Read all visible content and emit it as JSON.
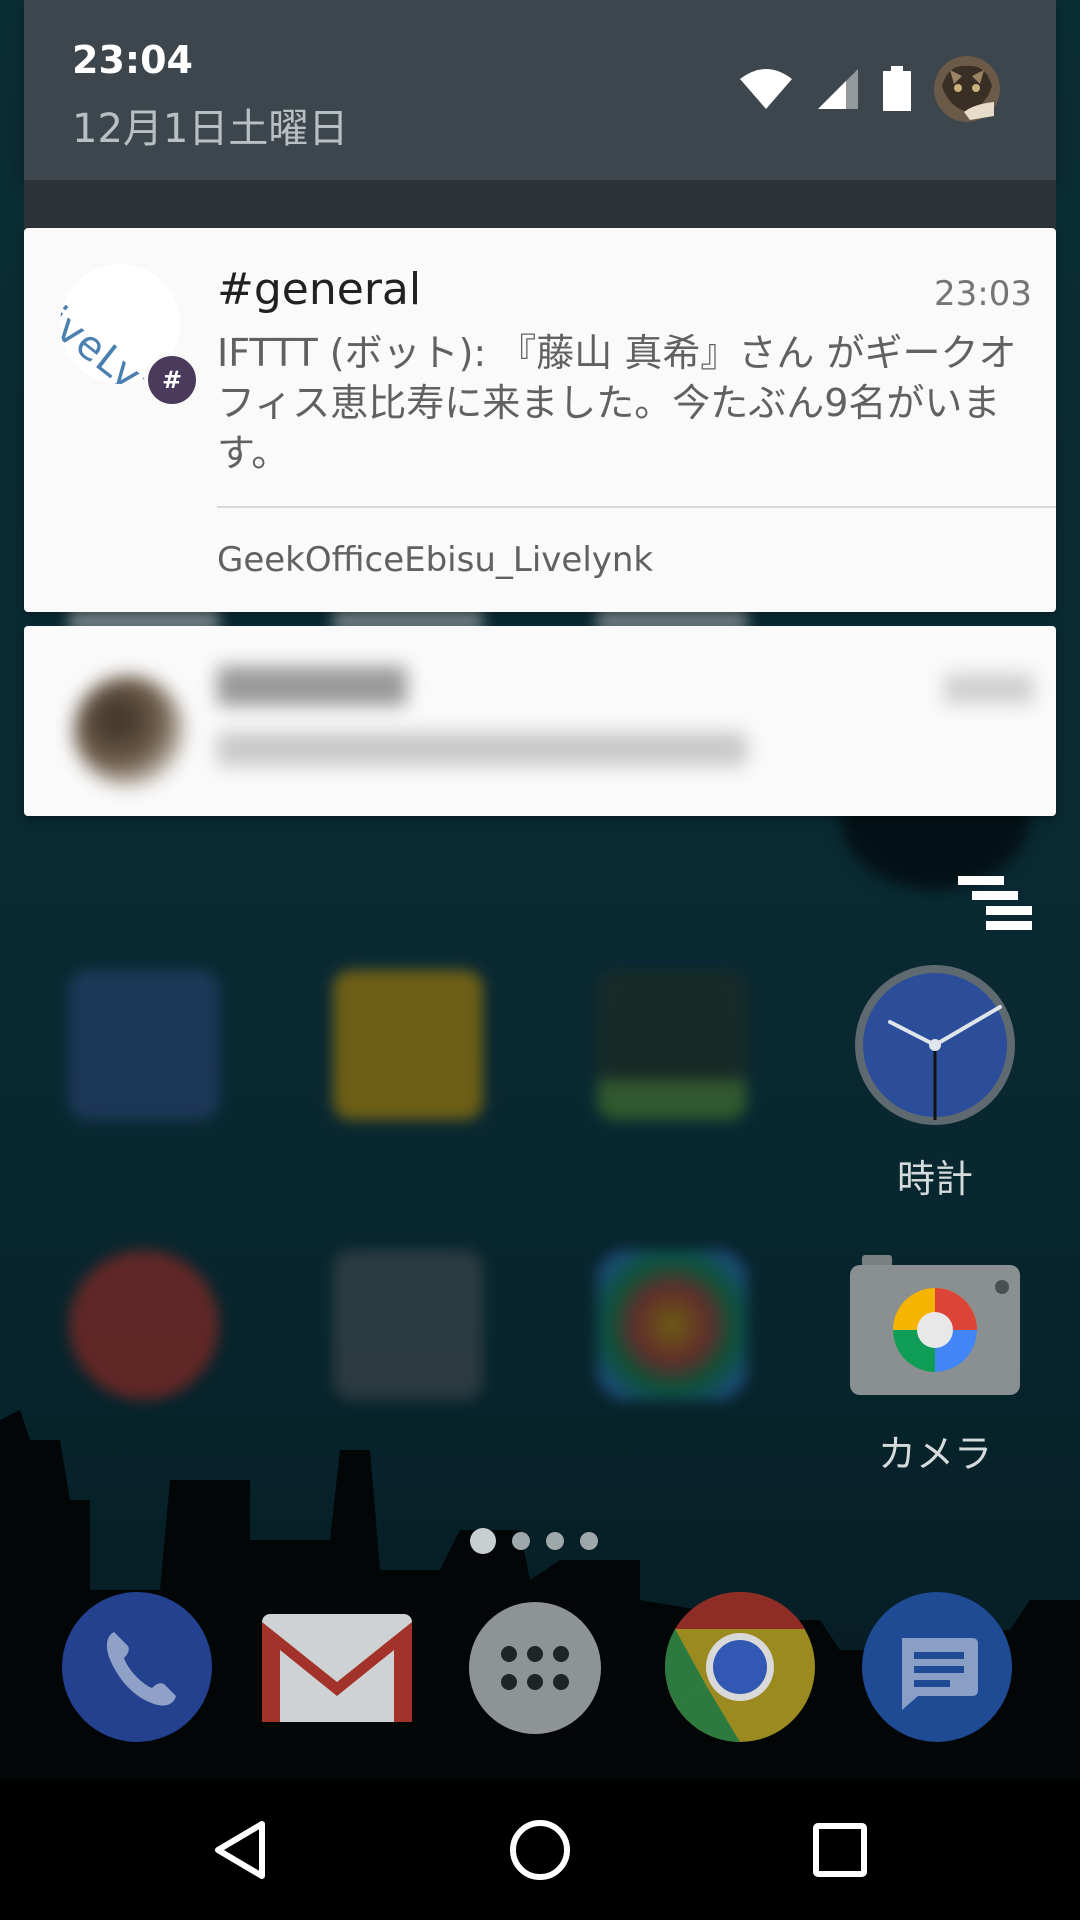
{
  "status": {
    "time": "23:04",
    "date": "12月1日土曜日"
  },
  "notification": {
    "avatar_text": "iveLyn",
    "badge": "#",
    "title": "#general",
    "time": "23:03",
    "body": "IFTTT (ボット): 『藤山 真希』さん がギークオフィス恵比寿に来ました。今たぶん9名がいます。",
    "action": "GeekOfficeEbisu_Livelynk"
  },
  "launcher": {
    "clock_label": "時計",
    "camera_label": "カメラ"
  },
  "colors": {
    "header_bg": "#3d464c",
    "card_bg": "#fafafa",
    "badge": "#4a3a5c",
    "chrome_red": "#db4437",
    "chrome_yellow": "#f4b400",
    "chrome_green": "#0f9d58",
    "chrome_blue": "#4285f4"
  }
}
